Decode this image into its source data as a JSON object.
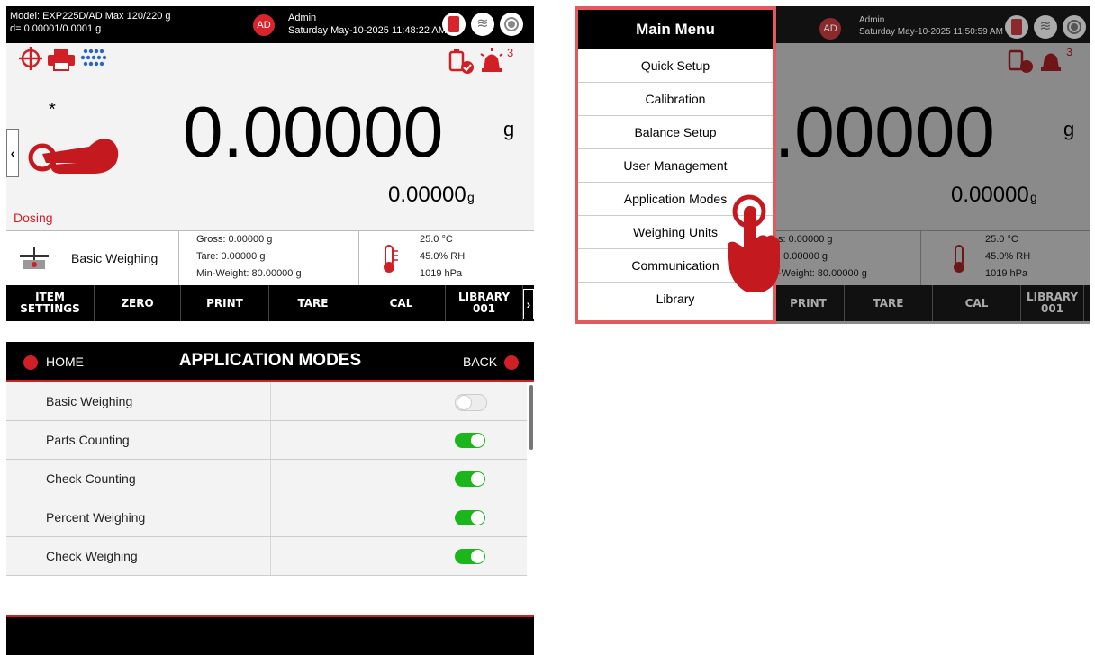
{
  "screen1": {
    "model_line1": "Model: EXP225D/AD   Max 120/220 g",
    "model_line2": "d= 0.00001/0.0001 g",
    "avatar": "AD",
    "user": "Admin",
    "datetime": "Saturday May-10-2025 11:48:22 AM",
    "alarm_count": "3",
    "asterisk": "*",
    "reading": "0.00000",
    "unit": "g",
    "sub_reading": "0.00000",
    "sub_unit": "g",
    "mode_status": "Dosing",
    "partial_label": "0",
    "app_mode": "Basic Weighing",
    "gross": "Gross: 0.00000 g",
    "tare": "Tare: 0.00000 g",
    "min_weight": "Min-Weight: 80.00000 g",
    "temperature": "25.0 °C",
    "humidity": "45.0% RH",
    "pressure": "1019 hPa",
    "buttons": {
      "item_settings": "ITEM\nSETTINGS",
      "zero": "ZERO",
      "print": "PRINT",
      "tare": "TARE",
      "cal": "CAL",
      "library": "LIBRARY\n001"
    },
    "icons": [
      "crosshair-icon",
      "printer-icon",
      "keypad-icon",
      "battery-check-icon",
      "alarm-icon",
      "usb-icon",
      "wifi-icon",
      "level-icon",
      "hand-pointer-icon",
      "thermometer-icon",
      "scale-icon"
    ],
    "accent_color": "#d21f25"
  },
  "screen2": {
    "avatar": "AD",
    "user": "Admin",
    "datetime": "Saturday May-10-2025 11:50:59 AM",
    "alarm_count": "3",
    "reading": ".00000",
    "unit": "g",
    "sub_reading": "0.00000",
    "sub_unit": "g",
    "gross_partial": "s: 0.00000 g",
    "tare_partial": ": 0.00000 g",
    "min_partial": "-Weight: 80.00000 g",
    "temperature": "25.0 °C",
    "humidity": "45.0% RH",
    "pressure": "1019 hPa",
    "buttons": {
      "print": "PRINT",
      "tare": "TARE",
      "cal": "CAL",
      "library": "LIBRARY\n001"
    },
    "menu_title": "Main Menu",
    "menu_items": [
      "Quick Setup",
      "Calibration",
      "Balance Setup",
      "User Management",
      "Application Modes",
      "Weighing Units",
      "Communication",
      "Library"
    ],
    "highlight_color": "#e35a5e"
  },
  "screen3": {
    "home": "HOME",
    "title": "APPLICATION MODES",
    "back": "BACK",
    "modes": [
      {
        "label": "Basic Weighing",
        "enabled": false
      },
      {
        "label": "Parts Counting",
        "enabled": true
      },
      {
        "label": "Check Counting",
        "enabled": true
      },
      {
        "label": "Percent Weighing",
        "enabled": true
      },
      {
        "label": "Check Weighing",
        "enabled": true
      }
    ],
    "toggle_on_color": "#1bb61b",
    "toggle_off_color": "#e6e6e6"
  }
}
